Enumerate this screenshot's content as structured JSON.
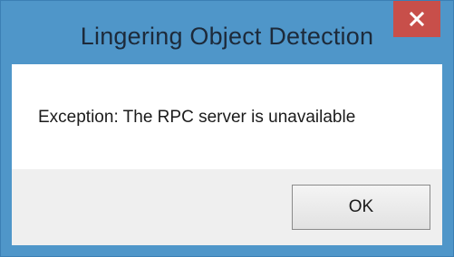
{
  "window": {
    "title": "Lingering Object Detection",
    "close_icon": "close-icon"
  },
  "dialog": {
    "message": "Exception: The RPC server is unavailable",
    "ok_label": "OK"
  },
  "colors": {
    "frame": "#4f96c9",
    "close_button": "#c84f4a",
    "content_bg": "#ffffff",
    "footer_bg": "#efefef"
  }
}
